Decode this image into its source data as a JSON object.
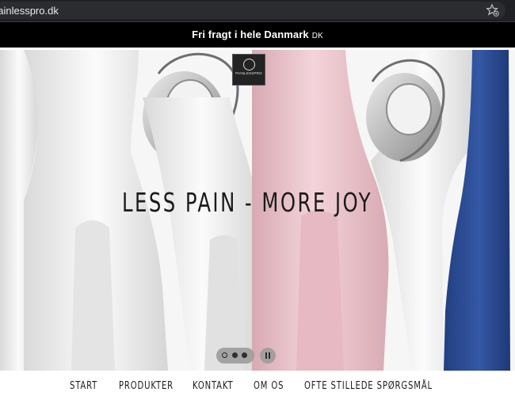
{
  "browser": {
    "url": "painlesspro.dk",
    "bookmark_icon": "star-add-icon"
  },
  "promo": {
    "text": "Fri fragt i hele Danmark",
    "suffix": "DK"
  },
  "hero": {
    "logo_text": "PAINLESSPRO",
    "headline": "LESS PAIN - MORE JOY",
    "slides_total": 3,
    "active_slide": 1,
    "pause_icon": "pause-icon"
  },
  "nav": {
    "items": [
      "START",
      "PRODUKTER",
      "KONTAKT",
      "OM OS",
      "OFTE STILLEDE SPØRGSMÅL"
    ]
  },
  "colors": {
    "promo_bg": "#000000",
    "pink_device": "#ecc4cc",
    "blue_device": "#2c4c92",
    "white_device": "#f2f2f2"
  }
}
